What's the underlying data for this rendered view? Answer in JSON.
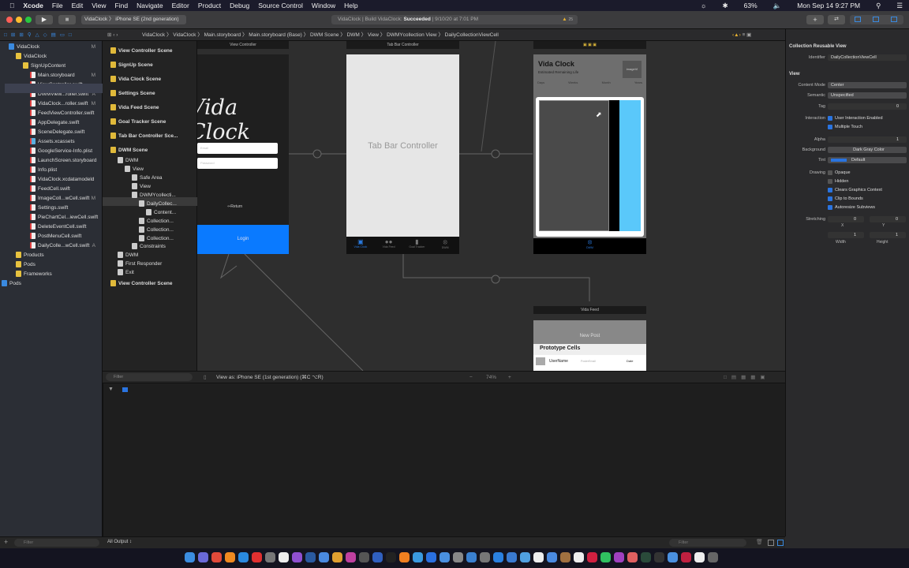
{
  "menubar": {
    "app": "Xcode",
    "items": [
      "File",
      "Edit",
      "View",
      "Find",
      "Navigate",
      "Editor",
      "Product",
      "Debug",
      "Source Control",
      "Window",
      "Help"
    ],
    "battery": "63%",
    "clock": "Mon Sep 14  9:27 PM"
  },
  "toolbar": {
    "scheme": "VidaClock",
    "device": "iPhone SE (2nd generation)",
    "status_prefix": "VidaClock | Build VidaClock: ",
    "status_result": "Succeeded",
    "status_time": " | 9/10/20 at 7:01 PM",
    "warnings": "25"
  },
  "jumpbar": [
    "VidaClock",
    "VidaClock",
    "Main.storyboard",
    "Main.storyboard (Base)",
    "DWM Scene",
    "DWM",
    "View",
    "DWMYcollection View",
    "DailyCollectionViewCell"
  ],
  "navigator": {
    "items": [
      {
        "label": "VidaClock",
        "badge": "M"
      },
      {
        "label": "VidaClock",
        "badge": ""
      },
      {
        "label": "SignUpContent",
        "badge": ""
      },
      {
        "label": "Main.storyboard",
        "badge": "M"
      },
      {
        "label": "ViewController.swift",
        "badge": ""
      },
      {
        "label": "DWMView...roller.swift",
        "badge": "A"
      },
      {
        "label": "VidaClock...roller.swift",
        "badge": "M"
      },
      {
        "label": "FeedViewController.swift",
        "badge": ""
      },
      {
        "label": "AppDelegate.swift",
        "badge": ""
      },
      {
        "label": "SceneDelegate.swift",
        "badge": ""
      },
      {
        "label": "Assets.xcassets",
        "badge": ""
      },
      {
        "label": "GoogleService-Info.plist",
        "badge": ""
      },
      {
        "label": "LaunchScreen.storyboard",
        "badge": ""
      },
      {
        "label": "Info.plist",
        "badge": ""
      },
      {
        "label": "VidaClock.xcdatamodeld",
        "badge": ""
      },
      {
        "label": "FeedCell.swift",
        "badge": ""
      },
      {
        "label": "ImageColl...wCell.swift",
        "badge": "M"
      },
      {
        "label": "Settings.swift",
        "badge": ""
      },
      {
        "label": "PieChartCel...iewCell.swift",
        "badge": ""
      },
      {
        "label": "DeleteEventCell.swift",
        "badge": ""
      },
      {
        "label": "PostMenuCell.swift",
        "badge": ""
      },
      {
        "label": "DailyColle...wCell.swift",
        "badge": "A"
      },
      {
        "label": "Products",
        "badge": ""
      },
      {
        "label": "Pods",
        "badge": ""
      },
      {
        "label": "Frameworks",
        "badge": ""
      },
      {
        "label": "Pods",
        "badge": ""
      }
    ],
    "filter_placeholder": "Filter"
  },
  "outline": {
    "items": [
      "View Controller Scene",
      "SignUp Scene",
      "Vida Clock Scene",
      "Settings Scene",
      "Vida Feed Scene",
      "Goal Tracker Scene",
      "Tab Bar Controller Sce...",
      "DWM Scene",
      "DWM",
      "View",
      "Safe Area",
      "View",
      "DWMYcollecti...",
      "DailyCollec...",
      "Content...",
      "Collection...",
      "Collection...",
      "Collection...",
      "Constraints",
      "DWM",
      "First Responder",
      "Exit",
      "View Controller Scene"
    ],
    "filter_placeholder": "Filter"
  },
  "canvas": {
    "vc": {
      "title": "View Controller",
      "logo": "Vida Clock",
      "email": "Email",
      "password": "Password",
      "return": "Return",
      "login": "Login"
    },
    "tabbar": {
      "title": "Tab Bar Controller",
      "label": "Tab Bar Controller",
      "tabs": [
        "Vida Clock",
        "Vida Feed",
        "Goal Tracker",
        "DWM"
      ]
    },
    "dwm": {
      "title": "Vida Clock",
      "subtitle": "Estimated Remaining Life",
      "image": "imageVi",
      "cols": [
        "Days",
        "Weeks",
        "Month",
        "Years"
      ],
      "tab": "DWM"
    },
    "feed": {
      "title": "Vida Feed",
      "new_post": "New Post",
      "proto": "Prototype Cells",
      "user": "UserName",
      "email": "PosterEmail",
      "date": "Date"
    },
    "view_as": "View as: iPhone SE (1st generation) (⌘C ⌥R)",
    "zoom": "74%"
  },
  "debug": {
    "output": "All Output ↕",
    "filter_placeholder": "Filter"
  },
  "inspector": {
    "section1": "Collection Reusable View",
    "identifier_label": "Identifier",
    "identifier": "DailyCollectionViewCell",
    "section2": "View",
    "content_mode_label": "Content Mode",
    "content_mode": "Center",
    "semantic_label": "Semantic",
    "semantic": "Unspecified",
    "tag_label": "Tag",
    "tag": "0",
    "interaction_label": "Interaction",
    "user_interaction": "User Interaction Enabled",
    "multiple_touch": "Multiple Touch",
    "alpha_label": "Alpha",
    "alpha": "1",
    "background_label": "Background",
    "background": "Dark Gray Color",
    "tint_label": "Tint",
    "tint": "Default",
    "drawing_label": "Drawing",
    "opaque": "Opaque",
    "hidden": "Hidden",
    "clears": "Clears Graphics Context",
    "clip": "Clip to Bounds",
    "autoresize": "Autoresize Subviews",
    "stretching_label": "Stretching",
    "sx": "0",
    "sy": "0",
    "x_label": "X",
    "y_label": "Y",
    "sw": "1",
    "sh": "1",
    "w_label": "Width",
    "h_label": "Height"
  },
  "dock_colors": [
    "#3b8de0",
    "#6a6ad8",
    "#e04a3a",
    "#f08a20",
    "#2a8ae0",
    "#e03030",
    "#777",
    "#eee",
    "#9050d0",
    "#2a5aa0",
    "#4a8ae0",
    "#e0a030",
    "#c040a0",
    "#555",
    "#3060c0",
    "#222",
    "#f08020",
    "#3a9ae0",
    "#2a70e0",
    "#4a90e0",
    "#888",
    "#3a80d0",
    "#777",
    "#2a80e0",
    "#3a7ad0",
    "#50a0e0",
    "#eee",
    "#4a8ae0",
    "#a07040",
    "#eee",
    "#d02040",
    "#30c060",
    "#a040c0",
    "#e06060",
    "#2a4a3a",
    "#333",
    "#4a90e0",
    "#c02040",
    "#eee",
    "#666"
  ]
}
